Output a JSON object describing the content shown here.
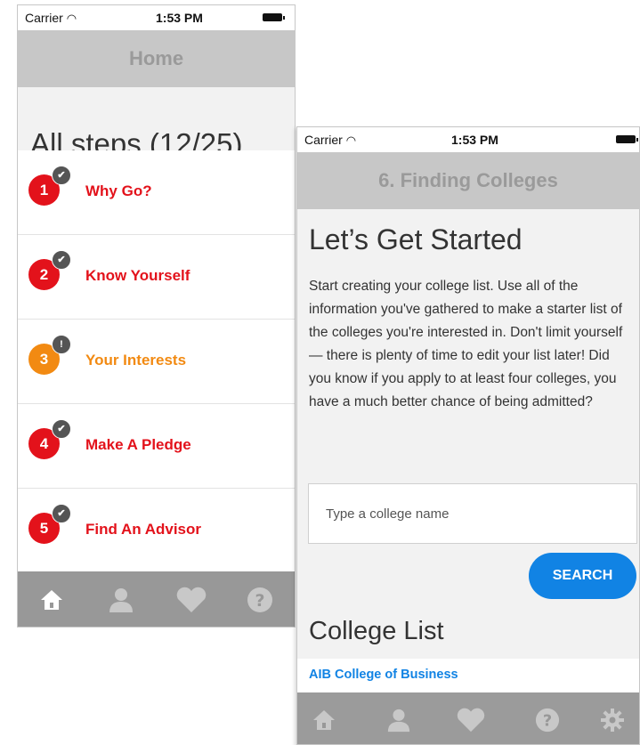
{
  "status_bar": {
    "carrier": "Carrier",
    "time": "1:53 PM"
  },
  "left_screen": {
    "nav_title": "Home",
    "heading": "All steps (12/25)",
    "steps": [
      {
        "number": "1",
        "label": "Why Go?",
        "status": "complete",
        "color": "#e3121b",
        "badge": "✔"
      },
      {
        "number": "2",
        "label": "Know Yourself",
        "status": "complete",
        "color": "#e3121b",
        "badge": "✔"
      },
      {
        "number": "3",
        "label": "Your Interests",
        "status": "incomplete",
        "color": "#f28a12",
        "badge": "!"
      },
      {
        "number": "4",
        "label": "Make A Pledge",
        "status": "complete",
        "color": "#e3121b",
        "badge": "✔"
      },
      {
        "number": "5",
        "label": "Find An Advisor",
        "status": "complete",
        "color": "#e3121b",
        "badge": "✔"
      }
    ],
    "tabs": [
      {
        "icon": "home-icon",
        "active": true
      },
      {
        "icon": "profile-icon",
        "active": false
      },
      {
        "icon": "heart-icon",
        "active": false
      },
      {
        "icon": "help-icon",
        "active": false
      }
    ]
  },
  "right_screen": {
    "nav_title": "6. Finding Colleges",
    "heading": "Let’s Get Started",
    "body": "Start creating your college list. Use all of the information you've gathered to make a starter list of the colleges you're interested in. Don't limit yourself — there is plenty of time to edit your list later! Did you know if you apply to at least four colleges, you have a much better chance of being admitted?",
    "search_placeholder": "Type a college name",
    "search_button": "SEARCH",
    "list_heading": "College List",
    "colleges": [
      {
        "name": "AIB College of Business"
      }
    ],
    "tabs": [
      {
        "icon": "home-icon",
        "active": false
      },
      {
        "icon": "profile-icon",
        "active": false
      },
      {
        "icon": "heart-icon",
        "active": false
      },
      {
        "icon": "help-icon",
        "active": false
      },
      {
        "icon": "settings-icon",
        "active": false
      }
    ]
  },
  "colors": {
    "accent_red": "#e3121b",
    "accent_orange": "#f28a12",
    "link_blue": "#1183e4",
    "nav_gray": "#c7c7c7",
    "tab_gray": "#989898"
  }
}
